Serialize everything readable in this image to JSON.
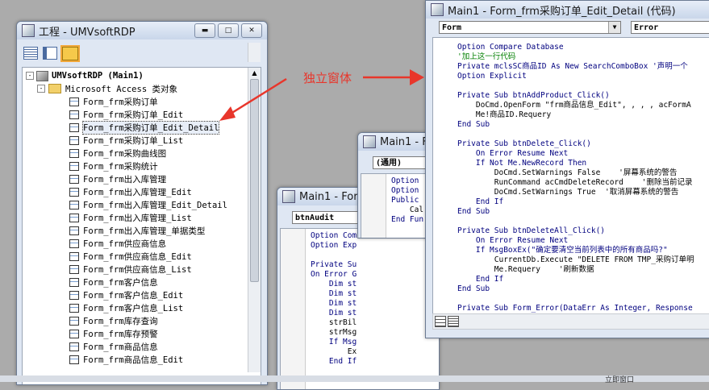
{
  "project_window": {
    "title": "工程 - UMVsoftRDP",
    "root_label": "UMVsoftRDP (Main1)",
    "folder_label": "Microsoft Access 类对象",
    "items": [
      "Form_frm采购订单",
      "Form_frm采购订单_Edit",
      "Form_frm采购订单_Edit_Detail",
      "Form_frm采购订单_List",
      "Form_frm采购曲线图",
      "Form_frm采购统计",
      "Form_frm出入库管理",
      "Form_frm出入库管理_Edit",
      "Form_frm出入库管理_Edit_Detail",
      "Form_frm出入库管理_List",
      "Form_frm出入库管理_单据类型",
      "Form_frm供应商信息",
      "Form_frm供应商信息_Edit",
      "Form_frm供应商信息_List",
      "Form_frm客户信息",
      "Form_frm客户信息_Edit",
      "Form_frm客户信息_List",
      "Form_frm库存查询",
      "Form_frm库存预警",
      "Form_frm商品信息",
      "Form_frm商品信息_Edit"
    ],
    "selected_index": 2
  },
  "annotation": {
    "text": "独立窗体",
    "color": "#e8362b"
  },
  "code_window_left": {
    "title": "Main1 - For",
    "object_combo": "btnAudit",
    "lines": [
      "Option Com",
      "Option Exp",
      "",
      "Private Su",
      "On Error G",
      "    Dim st",
      "    Dim st",
      "    Dim st",
      "    Dim st",
      "    strBil",
      "    strMsg",
      "    If Msg",
      "        Ex",
      "    End If"
    ]
  },
  "code_window_mid": {
    "title": "Main1 - F",
    "object_combo": "(通用)",
    "lines": [
      "Option",
      "Option",
      "Public",
      "    Cal",
      "End Fun"
    ]
  },
  "code_window_main": {
    "title": "Main1 - Form_frm采购订单_Edit_Detail (代码)",
    "object_combo": "Form",
    "proc_combo": "Error",
    "lines": [
      "Option Compare Database",
      "'加上这一行代码",
      "Private mclsSC商品ID As New SearchComboBox '声明一个",
      "Option Explicit",
      "",
      "Private Sub btnAddProduct_Click()",
      "    DoCmd.OpenForm \"frm商品信息_Edit\", , , , acFormA",
      "    Me!商品ID.Requery",
      "End Sub",
      "",
      "Private Sub btnDelete_Click()",
      "    On Error Resume Next",
      "    If Not Me.NewRecord Then",
      "        DoCmd.SetWarnings False    '屏幕系统的警告",
      "        RunCommand acCmdDeleteRecord    '删除当前记录",
      "        DoCmd.SetWarnings True  '取消屏幕系统的警告",
      "    End If",
      "End Sub",
      "",
      "Private Sub btnDeleteAll_Click()",
      "    On Error Resume Next",
      "    If MsgBoxEx(\"确定要清空当前列表中的所有商品吗?\"",
      "        CurrentDb.Execute \"DELETE FROM TMP_采购订单明",
      "        Me.Requery    '刷新数据",
      "    End If",
      "End Sub",
      "",
      "Private Sub Form_Error(DataErr As Integer, Response"
    ]
  },
  "taskbar": {
    "text": "立即窗口"
  }
}
